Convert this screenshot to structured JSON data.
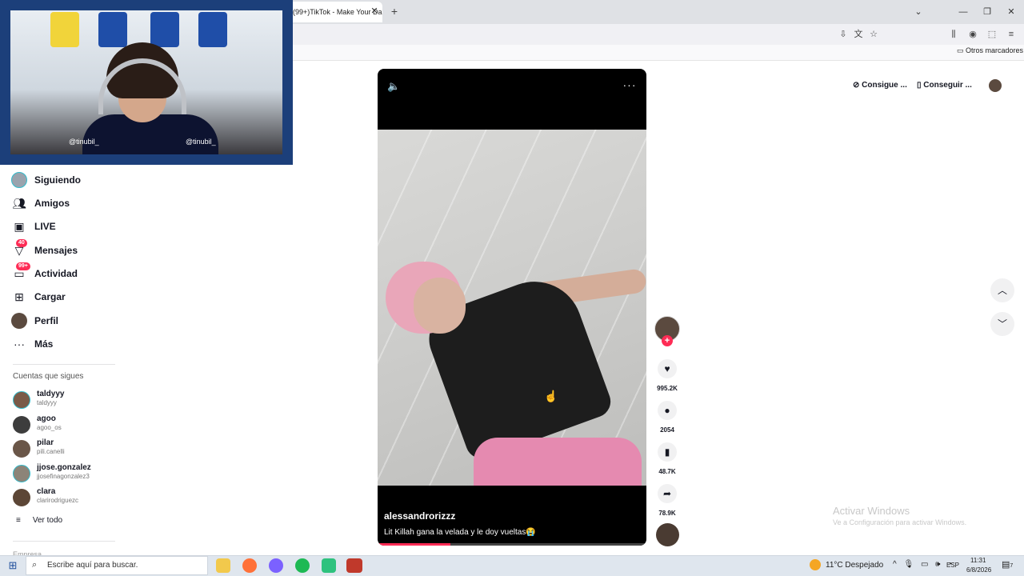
{
  "browser": {
    "tab_title": "(99+)TikTok - Make Your Da",
    "tab_close": "✕",
    "new_tab": "+",
    "window_controls": {
      "minimize": "—",
      "restore": "❐",
      "close": "✕",
      "tabs_menu": "⌄"
    },
    "bookmarks_folder": "Otros marcadores"
  },
  "webcam": {
    "handle_left": "@tinubil_",
    "handle_right": "@tinubil_"
  },
  "sidebar": {
    "items": [
      {
        "label": "Siguiendo",
        "icon": "following-avatar-icon"
      },
      {
        "label": "Amigos",
        "icon": "friends-icon"
      },
      {
        "label": "LIVE",
        "icon": "live-tv-icon"
      },
      {
        "label": "Mensajes",
        "icon": "messages-icon",
        "badge": "40"
      },
      {
        "label": "Actividad",
        "icon": "activity-icon",
        "badge": "99+"
      },
      {
        "label": "Cargar",
        "icon": "upload-icon"
      },
      {
        "label": "Perfil",
        "icon": "profile-avatar-icon"
      },
      {
        "label": "Más",
        "icon": "more-icon"
      }
    ],
    "following_title": "Cuentas que sigues",
    "accounts": [
      {
        "name": "taldyyy",
        "username": "taldyyy"
      },
      {
        "name": "agoo",
        "username": "agoo_os"
      },
      {
        "name": "pilar",
        "username": "pili.canelli"
      },
      {
        "name": "jjose.gonzalez",
        "username": "jjosefinagonzalez3"
      },
      {
        "name": "clara",
        "username": "clarirodriguezc"
      }
    ],
    "see_all": "Ver todo",
    "footer_section": "Empresa"
  },
  "header": {
    "coins_label": "Consigue ...",
    "app_label": "Conseguir ..."
  },
  "video": {
    "author": "alessandrorizzz",
    "caption": "Lit Killah gana la velada y le doy vueltas😭",
    "progress": 0.27,
    "more": "···",
    "mute": "🔈"
  },
  "actions": {
    "follow": "+",
    "likes": "995.2K",
    "comments": "2054",
    "saves": "48.7K",
    "shares": "78.9K"
  },
  "nav_arrows": {
    "up": "︿",
    "down": "﹀"
  },
  "watermark": {
    "line1": "Activar Windows",
    "line2": "Ve a Configuración para activar Windows."
  },
  "taskbar": {
    "search_placeholder": "Escribe aquí para buscar.",
    "weather": "11°C  Despejado",
    "language": "ESP",
    "time": "11:31",
    "date": "6/8/2026",
    "notifications": "7"
  },
  "colors": {
    "accent": "#fe2c55",
    "text": "#161823",
    "taskbar": "#dfe6ee"
  }
}
